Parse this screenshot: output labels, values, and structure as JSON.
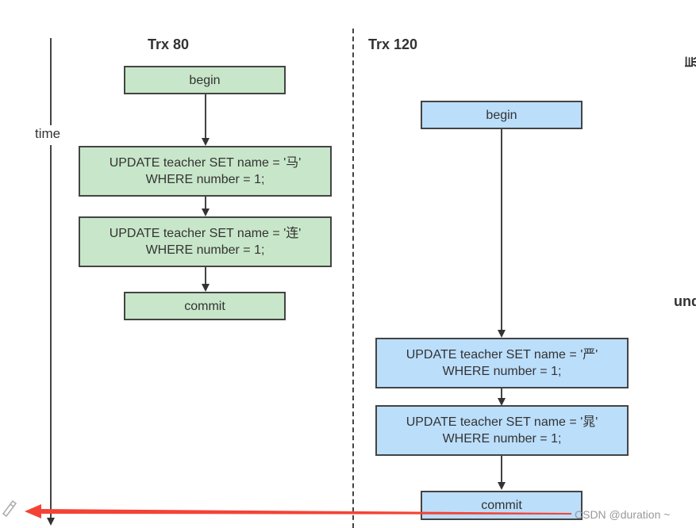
{
  "axis": {
    "label": "time"
  },
  "trx_left": {
    "title": "Trx 80",
    "color": "#c8e6c9",
    "steps": [
      {
        "line1": "begin",
        "line2": ""
      },
      {
        "line1": "UPDATE teacher  SET name = '马'",
        "line2": "WHERE number = 1;"
      },
      {
        "line1": "UPDATE teacher  SET name = '连'",
        "line2": "WHERE number = 1;"
      },
      {
        "line1": "commit",
        "line2": ""
      }
    ]
  },
  "trx_right": {
    "title": "Trx 120",
    "color": "#bbdefb",
    "steps": [
      {
        "line1": "begin",
        "line2": ""
      },
      {
        "line1": "UPDATE teacher  SET name = '严'",
        "line2": "WHERE number = 1;"
      },
      {
        "line1": "UPDATE teacher  SET name = '晁'",
        "line2": "WHERE number = 1;"
      },
      {
        "line1": "commit",
        "line2": ""
      }
    ]
  },
  "side_text": {
    "top": "当",
    "middle": "und"
  },
  "annotation": {
    "arrow_color": "#f44336",
    "pencil": "pencil-icon"
  },
  "watermark": "CSDN @duration ~"
}
